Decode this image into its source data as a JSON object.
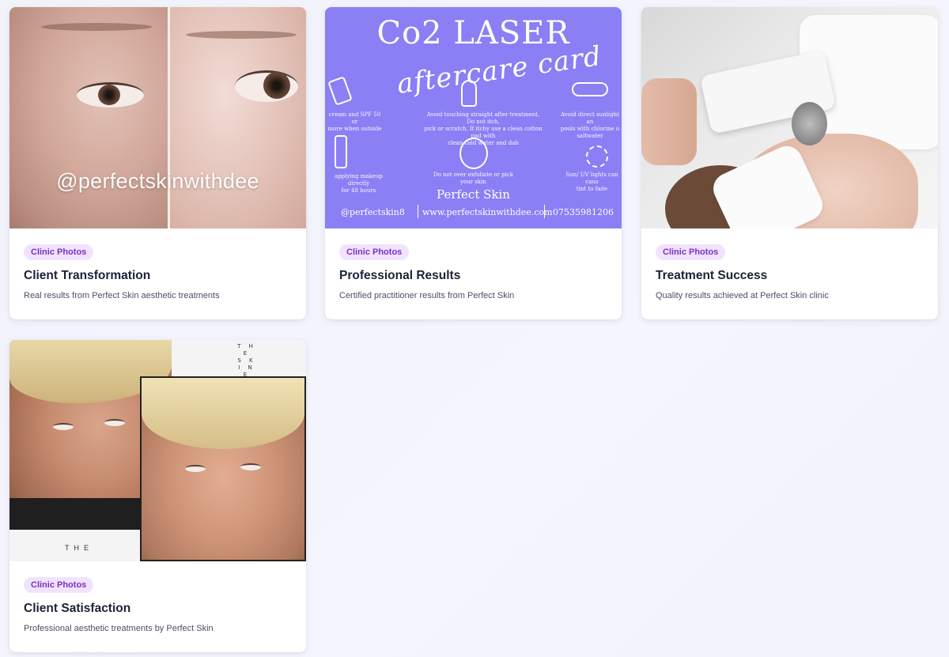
{
  "cards": [
    {
      "badge": "Clinic Photos",
      "title": "Client Transformation",
      "description": "Real results from Perfect Skin aesthetic treatments",
      "image": {
        "watermark": "@perfectskinwithdee"
      }
    },
    {
      "badge": "Clinic Photos",
      "title": "Professional Results",
      "description": "Certified practitioner results from Perfect Skin",
      "image": {
        "heading": "Co2 LASER",
        "script": "aftercare card",
        "brand": "Perfect Skin",
        "handle": "@perfectskin8",
        "website": "www.perfectskinwithdee.com",
        "phone": "07535981206",
        "tips": [
          "cream and SPF 50 or\nmore when outside",
          "Avoid touching straight after treatment. Do not itch,\npick or scratch. If itchy use a clean cotton pad with\nclean cold water and dab",
          "Avoid direct sunlight an\npools with chlorine o\nsaltwater",
          "applying makeup directly\nfor 48 hours",
          "Do not over exfoliate or pick\nyour skin",
          "Sun/ UV lights can caus\ntint to fade"
        ]
      }
    },
    {
      "badge": "Clinic Photos",
      "title": "Treatment Success",
      "description": "Quality results achieved at Perfect Skin clinic",
      "image": {}
    },
    {
      "badge": "Clinic Photos",
      "title": "Client Satisfaction",
      "description": "Professional aesthetic treatments by Perfect Skin",
      "image": {
        "label_top": "THE SKIN EDIT",
        "label_bottom": "THE"
      }
    }
  ],
  "colors": {
    "badge_text": "#7e2fc4",
    "badge_bg": "#f1e3ff",
    "title": "#1c2236",
    "description": "#4a5064",
    "aftercare_purple": "#8b7ff5",
    "page_bg": "#f2f3fb"
  }
}
